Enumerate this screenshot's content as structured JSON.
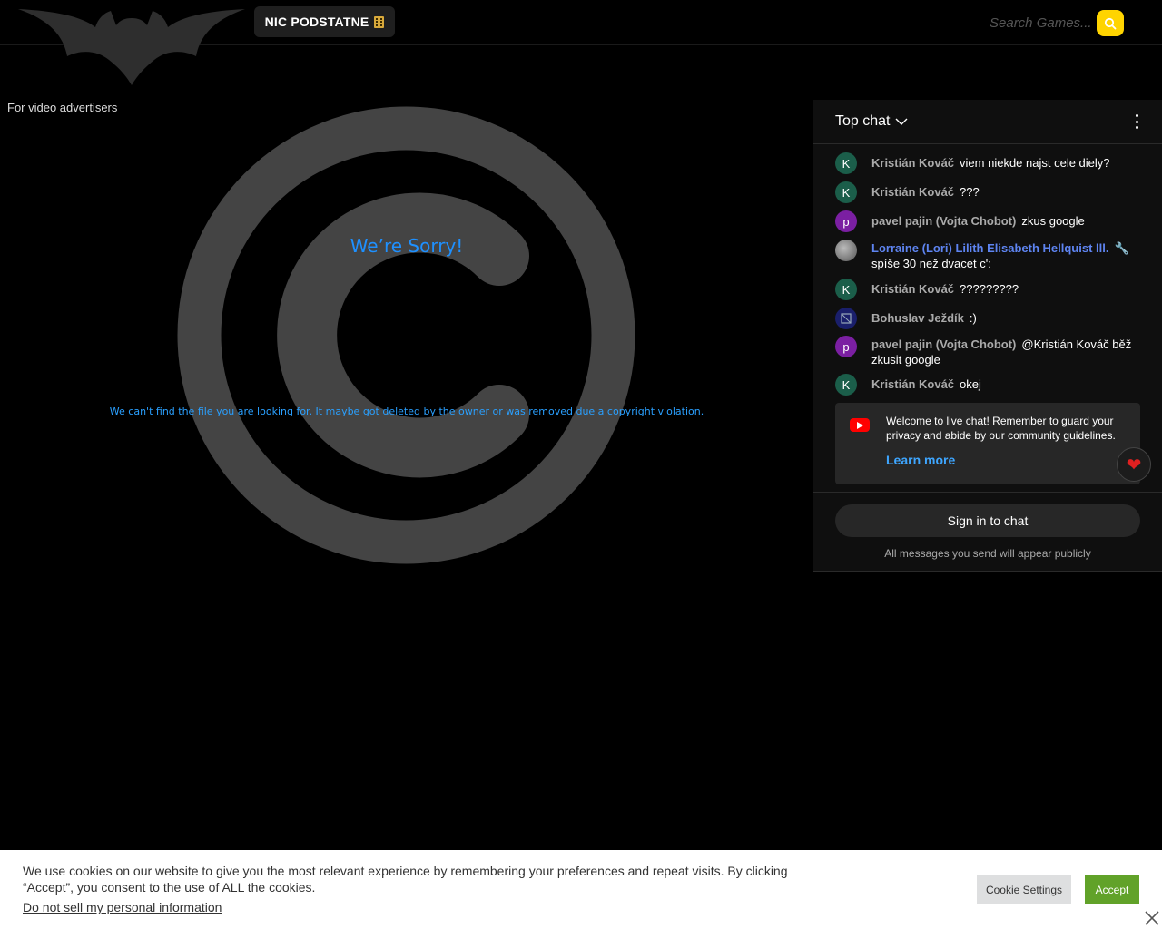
{
  "header": {
    "nav_label": "NIC PODSTATNE",
    "search_placeholder": "Search Games..."
  },
  "ad_label": "For video advertisers",
  "error": {
    "title": "We’re Sorry!",
    "message": "We can't find the file you are looking for. It maybe got deleted by the owner or was removed due a copyright violation."
  },
  "chat": {
    "title": "Top chat",
    "messages": [
      {
        "avatar": "K",
        "avatar_color": "#1b5e4a",
        "author": "Kristián Kováč",
        "text": "viem niekde najst cele diely?"
      },
      {
        "avatar": "K",
        "avatar_color": "#1b5e4a",
        "author": "Kristián Kováč",
        "text": "???"
      },
      {
        "avatar": "p",
        "avatar_color": "#7b1fa2",
        "author": "pavel pajin (Vojta Chobot)",
        "text": "zkus google"
      },
      {
        "avatar": "",
        "avatar_color": "#888888",
        "author": "Lorraine (Lori) Lilith Elisabeth Hellquist lll.",
        "text": "spíše 30 než dvacet c':"
      },
      {
        "avatar": "K",
        "avatar_color": "#1b5e4a",
        "author": "Kristián Kováč",
        "text": "?????????"
      },
      {
        "avatar": "",
        "avatar_color": "#1a1f6b",
        "author": "Bohuslav Ježdík",
        "text": ":)"
      },
      {
        "avatar": "p",
        "avatar_color": "#7b1fa2",
        "author": "pavel pajin (Vojta Chobot)",
        "text": "@Kristián Kováč běž zkusit google"
      },
      {
        "avatar": "K",
        "avatar_color": "#1b5e4a",
        "author": "Kristián Kováč",
        "text": "okej"
      }
    ],
    "welcome_text": "Welcome to live chat! Remember to guard your privacy and abide by our community guidelines.",
    "learn_more": "Learn more",
    "signin_label": "Sign in to chat",
    "public_note": "All messages you send will appear publicly"
  },
  "cookie": {
    "text": "We use cookies on our website to give you the most relevant experience by remembering your preferences and repeat visits. By clicking “Accept”, you consent to the use of ALL the cookies.",
    "link": "Do not sell my personal information",
    "settings_label": "Cookie Settings",
    "accept_label": "Accept"
  },
  "colors": {
    "accent_search": "#ffd400",
    "error_blue": "#1e90ff",
    "accept_green": "#61a229"
  }
}
